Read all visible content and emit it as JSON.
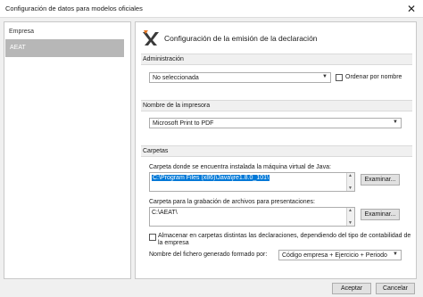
{
  "window": {
    "title": "Configuración de datos para modelos oficiales",
    "close_glyph": "✕"
  },
  "sidebar": {
    "items": [
      {
        "label": "Empresa"
      },
      {
        "label": "AEAT"
      }
    ]
  },
  "main": {
    "title": "Configuración de la emisión de la declaración"
  },
  "administracion": {
    "header": "Administración",
    "combo_value": "No seleccionada",
    "order_by_name_label": "Ordenar por nombre"
  },
  "impresora": {
    "header": "Nombre de la impresora",
    "combo_value": "Microsoft Print to PDF"
  },
  "carpetas": {
    "header": "Carpetas",
    "java_label": "Carpeta donde se encuentra instalada la máquina virtual de Java:",
    "java_path": "C:\\Program Files (x86)\\Java\\jre1.8.0_101\\",
    "java_browse": "Examinar...",
    "output_label": "Carpeta para la grabación de archivos para presentaciones:",
    "output_path": "C:\\AEAT\\",
    "output_browse": "Examinar...",
    "store_checkbox_label_1": "Almacenar en carpetas distintas las declaraciones, dependiendo del tipo de contabilidad de",
    "store_checkbox_label_2": "la empresa",
    "filename_label": "Nombre del fichero generado formado por:",
    "filename_combo_value": "Código empresa + Ejercicio + Periodo"
  },
  "footer": {
    "accept_label": "Aceptar",
    "cancel_label": "Cancelar"
  },
  "colors": {
    "accent": "#0078d7",
    "selected_sidebar": "#b7b7b7",
    "logo": "#3a3a3a"
  }
}
